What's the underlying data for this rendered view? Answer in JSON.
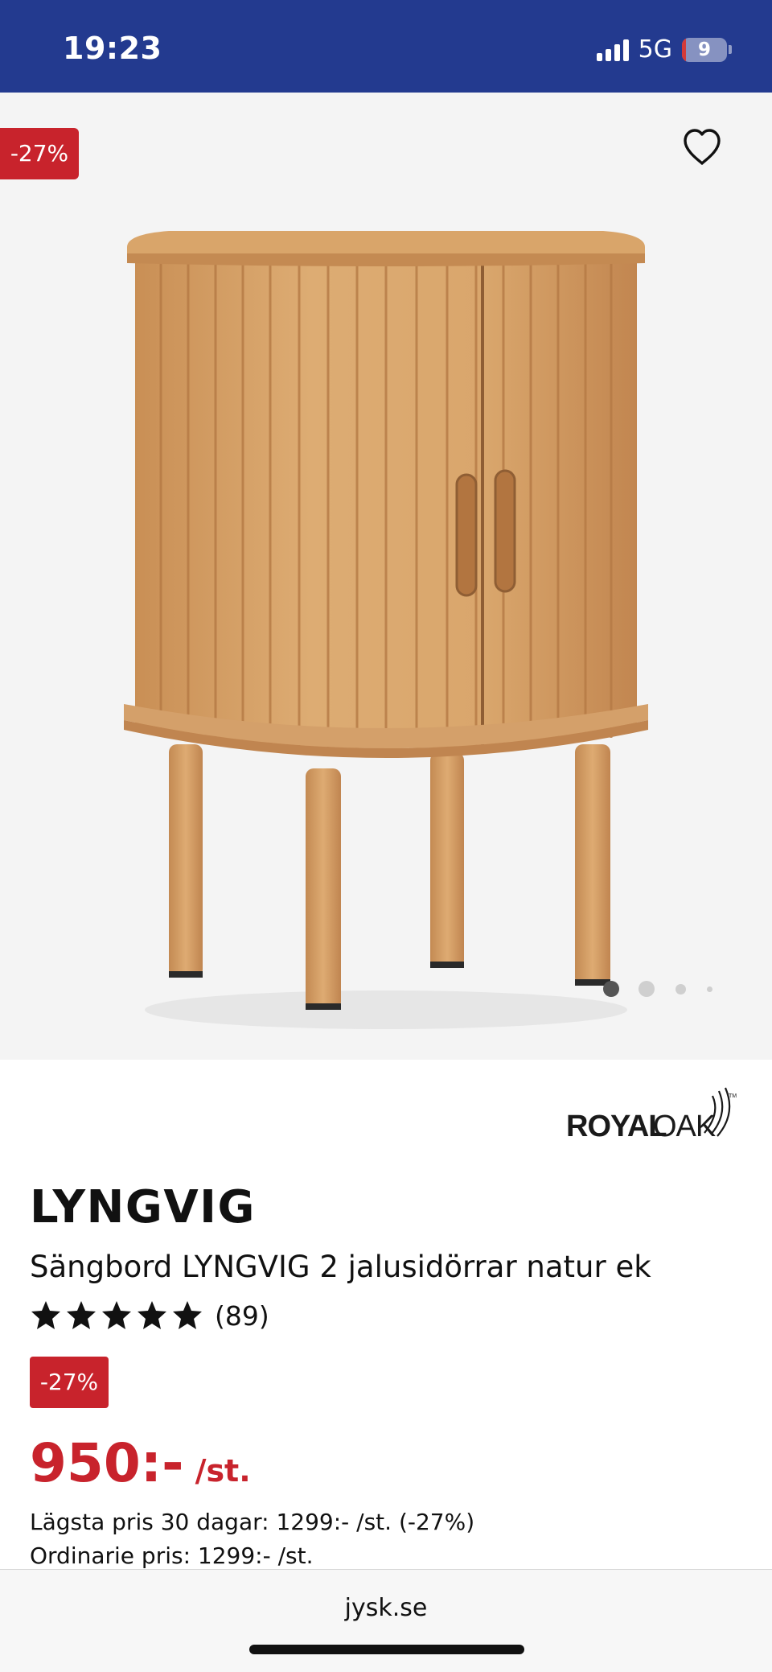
{
  "status_bar": {
    "time": "19:23",
    "network": "5G",
    "battery_level": "9",
    "battery_fraction": 0.09,
    "signal_icon": "signal-bars-icon"
  },
  "gallery": {
    "discount_tag": "-27%",
    "favorite_icon": "heart-outline-icon",
    "image_alt": "LYNGVIG oak bedside cabinet with tambour doors",
    "slide_count": 4,
    "active_slide": 1
  },
  "product": {
    "brand_logo_text": "ROYAL OAK",
    "title": "LYNGVIG",
    "subtitle": "Sängbord LYNGVIG 2 jalusidörrar natur ek",
    "rating_stars": 5,
    "review_count": "(89)",
    "discount_badge": "-27%",
    "price": "950:-",
    "price_unit": "/st.",
    "lowest_price": "Lägsta pris 30 dagar: 1299:- /st. (-27%)",
    "ordinary_price": "Ordinarie pris: 1299:- /st."
  },
  "browser": {
    "url": "jysk.se"
  },
  "colors": {
    "status_bar_bg": "#233a8f",
    "sale_red": "#c8232c",
    "gallery_bg": "#f4f4f4"
  }
}
